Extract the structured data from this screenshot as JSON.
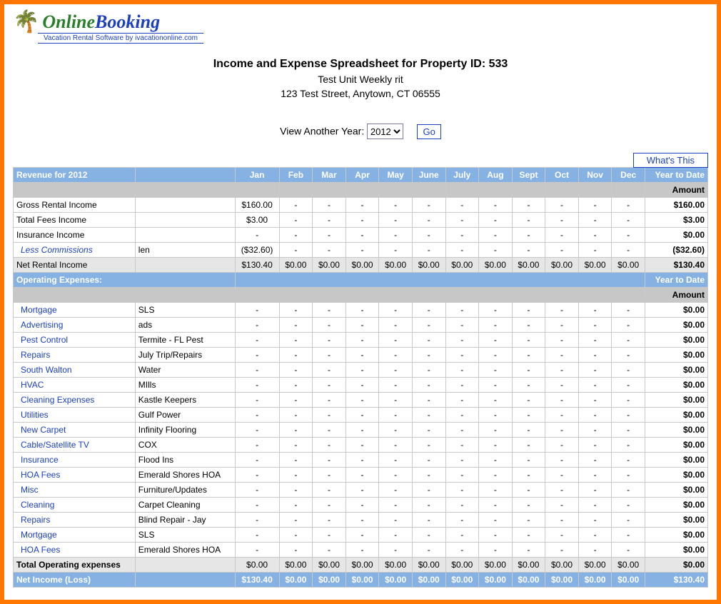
{
  "logo": {
    "online": "Online",
    "booking": "Booking",
    "sub": "Vacation Rental Software by ivacationonline.com"
  },
  "header": {
    "title": "Income and Expense Spreadsheet for Property ID: 533",
    "sub1": "Test Unit Weekly rit",
    "sub2": "123 Test Street, Anytown, CT 06555"
  },
  "year_picker": {
    "label": "View Another Year:",
    "selected": "2012",
    "go": "Go"
  },
  "whats_this": "What's This",
  "months": [
    "Jan",
    "Feb",
    "Mar",
    "Apr",
    "May",
    "June",
    "July",
    "Aug",
    "Sept",
    "Oct",
    "Nov",
    "Dec"
  ],
  "revenue": {
    "header": "Revenue for 2012",
    "ytd_header": "Year to Date",
    "amount_header": "Amount",
    "rows": [
      {
        "label": "Gross Rental Income",
        "note": "",
        "jan": "$160.00",
        "months": [
          "-",
          "-",
          "-",
          "-",
          "-",
          "-",
          "-",
          "-",
          "-",
          "-",
          "-"
        ],
        "ytd": "$160.00",
        "link": false
      },
      {
        "label": "Total Fees Income",
        "note": "",
        "jan": "$3.00",
        "months": [
          "-",
          "-",
          "-",
          "-",
          "-",
          "-",
          "-",
          "-",
          "-",
          "-",
          "-"
        ],
        "ytd": "$3.00",
        "link": false
      },
      {
        "label": "Insurance Income",
        "note": "",
        "jan": "-",
        "months": [
          "-",
          "-",
          "-",
          "-",
          "-",
          "-",
          "-",
          "-",
          "-",
          "-",
          "-"
        ],
        "ytd": "$0.00",
        "link": false
      },
      {
        "label": "Less Commissions",
        "note": "len",
        "jan": "($32.60)",
        "months": [
          "-",
          "-",
          "-",
          "-",
          "-",
          "-",
          "-",
          "-",
          "-",
          "-",
          "-"
        ],
        "ytd": "($32.60)",
        "italic": true
      }
    ],
    "net": {
      "label": "Net Rental Income",
      "jan": "$130.40",
      "months": [
        "$0.00",
        "$0.00",
        "$0.00",
        "$0.00",
        "$0.00",
        "$0.00",
        "$0.00",
        "$0.00",
        "$0.00",
        "$0.00",
        "$0.00"
      ],
      "ytd": "$130.40"
    }
  },
  "expenses": {
    "header": "Operating Expenses:",
    "ytd_header": "Year to Date",
    "amount_header": "Amount",
    "rows": [
      {
        "label": "Mortgage",
        "note": "SLS",
        "ytd": "$0.00"
      },
      {
        "label": "Advertising",
        "note": "ads",
        "ytd": "$0.00"
      },
      {
        "label": "Pest Control",
        "note": "Termite - FL Pest",
        "ytd": "$0.00"
      },
      {
        "label": "Repairs",
        "note": "July Trip/Repairs",
        "ytd": "$0.00"
      },
      {
        "label": "South Walton",
        "note": "Water",
        "ytd": "$0.00"
      },
      {
        "label": "HVAC",
        "note": "MIlls",
        "ytd": "$0.00"
      },
      {
        "label": "Cleaning Expenses",
        "note": "Kastle Keepers",
        "ytd": "$0.00"
      },
      {
        "label": "Utilities",
        "note": "Gulf Power",
        "ytd": "$0.00"
      },
      {
        "label": "New Carpet",
        "note": "Infinity Flooring",
        "ytd": "$0.00"
      },
      {
        "label": "Cable/Satellite TV",
        "note": "COX",
        "ytd": "$0.00"
      },
      {
        "label": "Insurance",
        "note": "Flood Ins",
        "ytd": "$0.00"
      },
      {
        "label": "HOA Fees",
        "note": "Emerald Shores HOA",
        "ytd": "$0.00"
      },
      {
        "label": "Misc",
        "note": "Furniture/Updates",
        "ytd": "$0.00"
      },
      {
        "label": "Cleaning",
        "note": "Carpet Cleaning",
        "ytd": "$0.00"
      },
      {
        "label": "Repairs",
        "note": "Blind Repair - Jay",
        "ytd": "$0.00"
      },
      {
        "label": "Mortgage",
        "note": "SLS",
        "ytd": "$0.00"
      },
      {
        "label": "HOA Fees",
        "note": "Emerald Shores HOA",
        "ytd": "$0.00"
      }
    ],
    "total": {
      "label": "Total Operating expenses",
      "months": [
        "$0.00",
        "$0.00",
        "$0.00",
        "$0.00",
        "$0.00",
        "$0.00",
        "$0.00",
        "$0.00",
        "$0.00",
        "$0.00",
        "$0.00",
        "$0.00"
      ],
      "ytd": "$0.00"
    },
    "net": {
      "label": "Net Income (Loss)",
      "months": [
        "$130.40",
        "$0.00",
        "$0.00",
        "$0.00",
        "$0.00",
        "$0.00",
        "$0.00",
        "$0.00",
        "$0.00",
        "$0.00",
        "$0.00",
        "$0.00"
      ],
      "ytd": "$130.40"
    }
  }
}
